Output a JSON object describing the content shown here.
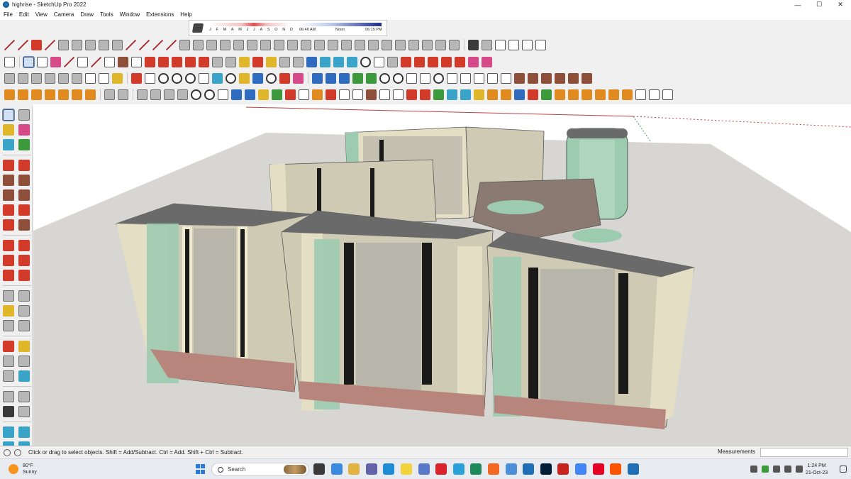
{
  "window": {
    "title": "highrise - SketchUp Pro 2022",
    "minimize_glyph": "—",
    "maximize_glyph": "☐",
    "close_glyph": "✕"
  },
  "menu": [
    "File",
    "Edit",
    "View",
    "Camera",
    "Draw",
    "Tools",
    "Window",
    "Extensions",
    "Help"
  ],
  "shadow_settings": {
    "months": [
      "J",
      "F",
      "M",
      "A",
      "M",
      "J",
      "J",
      "A",
      "S",
      "O",
      "N",
      "D"
    ],
    "time_start": "06:40 AM",
    "time_noon": "Noon",
    "time_end": "06:15 PM"
  },
  "status": {
    "hint": "Click or drag to select objects. Shift = Add/Subtract. Ctrl = Add. Shift + Ctrl = Subtract.",
    "measurements_label": "Measurements",
    "measurements_value": ""
  },
  "taskbar": {
    "weather_temp": "80°F",
    "weather_desc": "Sunny",
    "search_placeholder": "Search",
    "time": "1:24 PM",
    "date": "21-Oct-23",
    "pinned_apps": [
      "task-view",
      "copilot",
      "file-explorer",
      "teams",
      "calendar",
      "sticky-notes",
      "file-manager",
      "opera",
      "telegram",
      "photos",
      "brave",
      "edge-dev",
      "sketchup-taskbar",
      "photoshop",
      "adobe",
      "chrome",
      "pinterest",
      "soundcloud",
      "sketchup-active"
    ],
    "app_colors": [
      "#3a3a3a",
      "#3b8be0",
      "#e3b341",
      "#6264a7",
      "#1f8cd6",
      "#f3d33b",
      "#5a78c8",
      "#d8232a",
      "#2aa1d8",
      "#1e8a5a",
      "#f26722",
      "#4b8fd8",
      "#1f6fb6",
      "#001e36",
      "#c7241d",
      "#4285f4",
      "#e60023",
      "#ff5500",
      "#1f6fb6"
    ]
  },
  "colors": {
    "sky": "#ffffff",
    "ground": "#d7d6d2",
    "facade_beige": "#e4dec5",
    "glass_green": "#9ccbb0",
    "roof": "#6a6a6a",
    "base_red": "#b8857d",
    "axis_red": "#c04040",
    "axis_green": "#40a060"
  },
  "icons": {
    "titlebar": "sketchup-logo-icon",
    "weather": "sun-icon",
    "search": "search-icon"
  }
}
